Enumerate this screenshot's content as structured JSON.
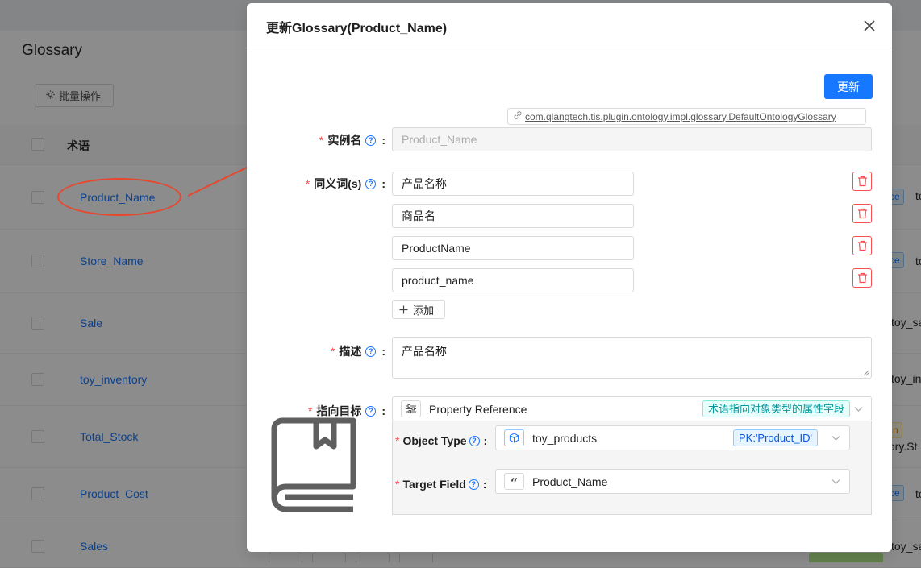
{
  "background": {
    "page_title": "Glossary",
    "batch_button_label": "批量操作",
    "table": {
      "header_term": "术语",
      "rows": [
        {
          "name": "Product_Name",
          "tag": "ce",
          "trail": "to"
        },
        {
          "name": "Store_Name",
          "tag": "ce",
          "trail": "to"
        },
        {
          "name": "Sale",
          "tag": "",
          "trail": "toy_sa"
        },
        {
          "name": "toy_inventory",
          "tag": "",
          "trail": "toy_in"
        },
        {
          "name": "Total_Stock",
          "tag": "n",
          "trail": "tory.St"
        },
        {
          "name": "Product_Cost",
          "tag": "ce",
          "trail": "to"
        },
        {
          "name": "Sales",
          "tag": "",
          "trail": "toy_sa"
        }
      ]
    }
  },
  "modal": {
    "title": "更新Glossary(Product_Name)",
    "update_button": "更新",
    "plugin_class": "com.qlangtech.tis.plugin.ontology.impl.glossary.DefaultOntologyGlossary",
    "fields": {
      "instance_name": {
        "label": "实例名",
        "placeholder": "Product_Name"
      },
      "synonyms": {
        "label": "同义词(s)",
        "values": [
          "产品名称",
          "商品名",
          "ProductName",
          "product_name"
        ],
        "add_label": "添加"
      },
      "description": {
        "label": "描述",
        "value": "产品名称"
      },
      "target": {
        "label": "指向目标",
        "value": "Property Reference",
        "tag": "术语指向对象类型的属性字段",
        "object_type": {
          "label": "Object Type",
          "value": "toy_products",
          "tag": "PK:'Product_ID'"
        },
        "target_field": {
          "label": "Target Field",
          "value": "Product_Name"
        }
      }
    }
  },
  "colors": {
    "primary": "#1677ff",
    "danger": "#ff4d4f",
    "annotation": "#e8472d",
    "cyan": "#08979c"
  }
}
